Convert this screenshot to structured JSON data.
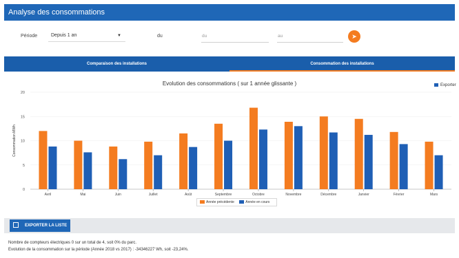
{
  "app": {
    "title": "Analyse des consommations"
  },
  "filters": {
    "period_label": "Période",
    "period_value": "Depuis 1 an",
    "du_label": "du",
    "du_placeholder": "du",
    "au_placeholder": "au"
  },
  "tabs": [
    {
      "label": "Comparaison des installations"
    },
    {
      "label": "Consommation des installations"
    }
  ],
  "export_top": "Exporter",
  "chart_data": {
    "type": "bar",
    "title": "Evolution des consommations ( sur 1 année glissante )",
    "ylabel": "Consommation MWh",
    "ylim": [
      0,
      20
    ],
    "yticks": [
      0,
      5,
      10,
      15,
      20
    ],
    "categories": [
      "Avril",
      "Mai",
      "Juin",
      "Juillet",
      "Août",
      "Septembre",
      "Octobre",
      "Novembre",
      "Décembre",
      "Janvier",
      "Février",
      "Mars"
    ],
    "series": [
      {
        "name": "Année précédente",
        "color": "#f47c20",
        "values": [
          12.0,
          10.0,
          8.8,
          9.8,
          11.5,
          13.5,
          16.8,
          13.9,
          15.0,
          14.5,
          11.8,
          9.8
        ]
      },
      {
        "name": "Année en cours",
        "color": "#1f5fb5",
        "values": [
          8.8,
          7.6,
          6.2,
          7.0,
          8.7,
          10.0,
          12.3,
          13.0,
          11.7,
          11.2,
          9.3,
          7.0
        ]
      }
    ]
  },
  "export_list": "EXPORTER LA LISTE",
  "notes": [
    "Nombre de compteurs électriques 0 sur un total de 4, soit 0% du parc.",
    "Evolution de la consommation sur la période (Année 2018 vs 2017) : -34346227 Wh, soit -23,24%."
  ]
}
